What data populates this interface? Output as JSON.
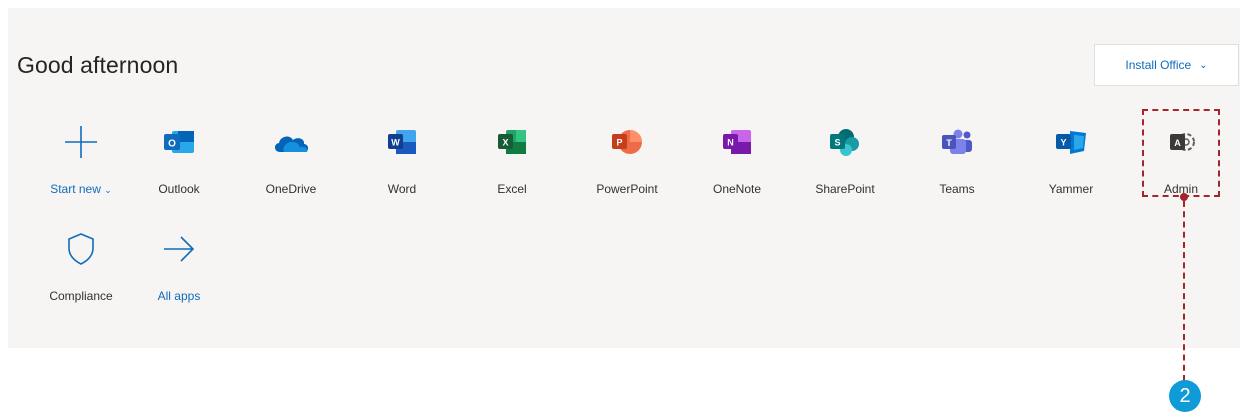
{
  "header": {
    "greeting": "Good afternoon",
    "install_label": "Install Office"
  },
  "apps": [
    {
      "label": "Start new",
      "icon": "plus-icon"
    },
    {
      "label": "Outlook",
      "icon": "outlook-icon"
    },
    {
      "label": "OneDrive",
      "icon": "onedrive-icon"
    },
    {
      "label": "Word",
      "icon": "word-icon"
    },
    {
      "label": "Excel",
      "icon": "excel-icon"
    },
    {
      "label": "PowerPoint",
      "icon": "powerpoint-icon"
    },
    {
      "label": "OneNote",
      "icon": "onenote-icon"
    },
    {
      "label": "SharePoint",
      "icon": "sharepoint-icon"
    },
    {
      "label": "Teams",
      "icon": "teams-icon"
    },
    {
      "label": "Yammer",
      "icon": "yammer-icon"
    },
    {
      "label": "Admin",
      "icon": "admin-icon"
    }
  ],
  "apps_row2": [
    {
      "label": "Compliance",
      "icon": "shield-icon"
    },
    {
      "label": "All apps",
      "icon": "arrow-right-icon"
    }
  ],
  "annotation": {
    "step_number": "2",
    "color": "#a4262c",
    "badge_color": "#0f9ad8"
  },
  "colors": {
    "accent": "#0f6cbd",
    "panel_bg": "#f7f5f3"
  }
}
